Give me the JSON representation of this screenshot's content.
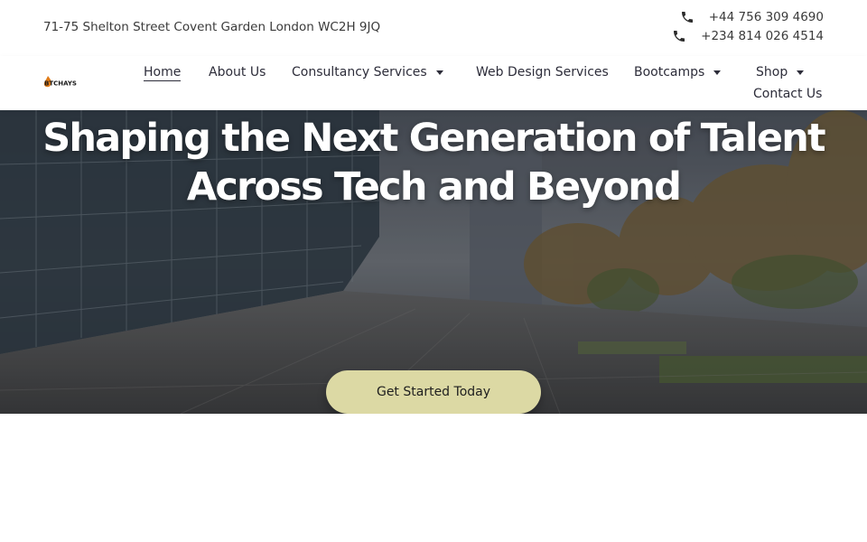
{
  "topbar": {
    "address": "71-75 Shelton Street Covent Garden London WC2H 9JQ",
    "phones": [
      "+44 756 309 4690",
      "+234 814 026 4514"
    ]
  },
  "logo": {
    "text": "BTCHAYS",
    "icon": "flame-logo-icon"
  },
  "nav": {
    "items": [
      {
        "label": "Home",
        "active": true
      },
      {
        "label": "About Us"
      },
      {
        "label": "Consultancy Services",
        "dropdown": true
      },
      {
        "label": "Web Design Services"
      },
      {
        "label": "Bootcamps",
        "dropdown": true
      },
      {
        "label": "Shop",
        "dropdown": true
      },
      {
        "label": "Contact Us"
      }
    ]
  },
  "hero": {
    "title_line1": "Shaping the Next Generation of Talent",
    "title_line2": "Across Tech and Beyond",
    "cta_label": "Get Started Today"
  },
  "colors": {
    "cta_bg": "#dcd9a4",
    "logo_accent": "#e07b18"
  }
}
